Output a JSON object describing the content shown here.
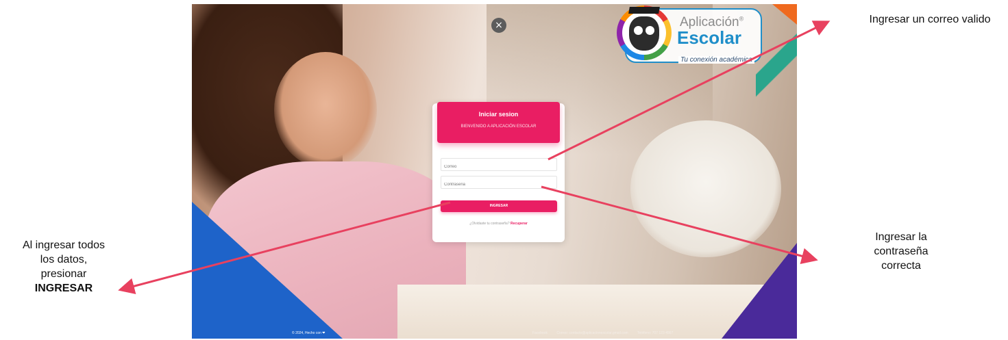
{
  "login_page": {
    "close_label": "×",
    "logo": {
      "name_top": "Aplicación",
      "registered": "®",
      "name_bottom": "Escolar",
      "tagline": "Tu conexión académica"
    },
    "card": {
      "title": "Iniciar sesion",
      "subtitle": "BIENVENIDO A APLICACIÓN ESCOLAR",
      "email_placeholder": "Correo",
      "password_placeholder": "Contraseña",
      "submit_label": "INGRESAR",
      "forgot_text": "¿Olvidaste tu contraseña?",
      "recover_link": "Recuperar"
    },
    "footer": {
      "copyright": "© 2024, Hecho con",
      "heart": "❤",
      "facebook": "Facebook",
      "email": "Correo: contacto@aplicacionescolar.gmail.com",
      "phone": "Teléfono: 707 123 4567"
    }
  },
  "annotations": {
    "email_note": "Ingresar un correo valido",
    "password_note_l1": "Ingresar la",
    "password_note_l2": "contraseña",
    "password_note_l3": "correcta",
    "submit_note_l1": "Al ingresar todos",
    "submit_note_l2": "los datos,",
    "submit_note_l3": "presionar",
    "submit_note_bold": "INGRESAR"
  },
  "colors": {
    "brand_pink": "#e91e63",
    "arrow_red": "#e8415f",
    "logo_blue": "#1f8ec9"
  }
}
